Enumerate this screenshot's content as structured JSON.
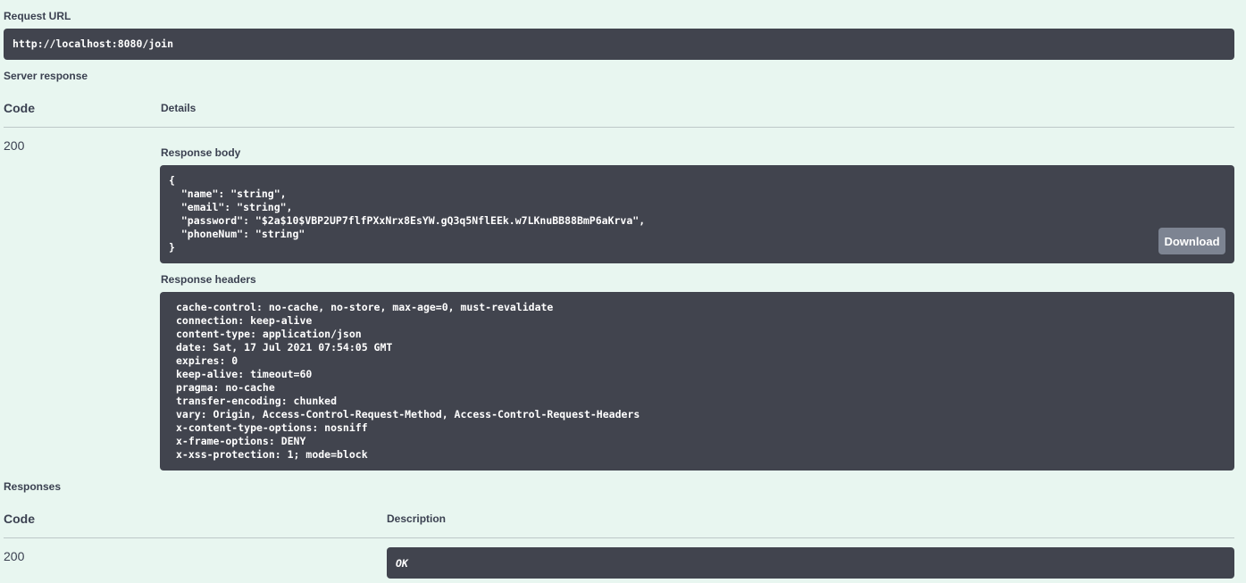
{
  "request_url": {
    "label": "Request URL",
    "value": "http://localhost:8080/join"
  },
  "server_response": {
    "label": "Server response",
    "code_header": "Code",
    "details_header": "Details",
    "code": "200",
    "response_body_label": "Response body",
    "response_body": "{\n  \"name\": \"string\",\n  \"email\": \"string\",\n  \"password\": \"$2a$10$VBP2UP7flfPXxNrx8EsYW.gQ3q5NflEEk.w7LKnuBB88BmP6aKrva\",\n  \"phoneNum\": \"string\"\n}",
    "download_label": "Download",
    "response_headers_label": "Response headers",
    "headers": [
      "cache-control: no-cache, no-store, max-age=0, must-revalidate",
      "connection: keep-alive",
      "content-type: application/json",
      "date: Sat, 17 Jul 2021 07:54:05 GMT",
      "expires: 0",
      "keep-alive: timeout=60",
      "pragma: no-cache",
      "transfer-encoding: chunked",
      "vary: Origin, Access-Control-Request-Method, Access-Control-Request-Headers",
      "x-content-type-options: nosniff",
      "x-frame-options: DENY",
      "x-xss-protection: 1; mode=block"
    ]
  },
  "responses": {
    "label": "Responses",
    "code_header": "Code",
    "description_header": "Description",
    "code": "200",
    "description": "OK"
  },
  "colors": {
    "background": "#e8f6f0",
    "code_block": "#41444e",
    "button": "#7d8492",
    "text": "#3b4151"
  }
}
